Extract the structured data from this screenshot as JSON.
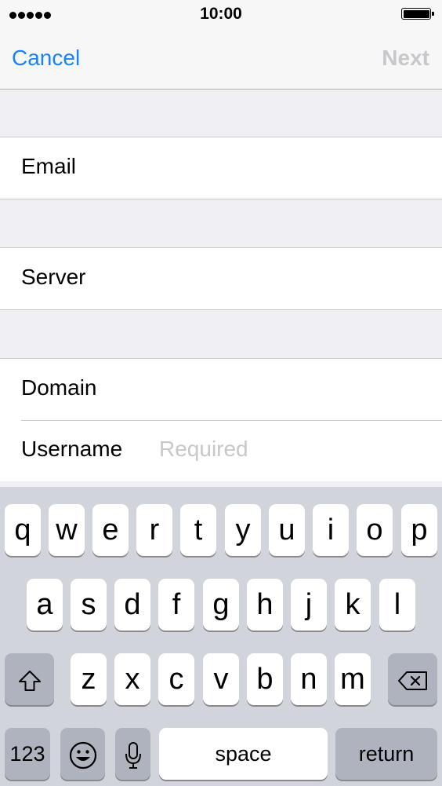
{
  "status_bar": {
    "time": "10:00",
    "signal_dots": 5
  },
  "nav": {
    "cancel_label": "Cancel",
    "next_label": "Next"
  },
  "form": {
    "email_label": "Email",
    "server_label": "Server",
    "domain_label": "Domain",
    "username_label": "Username",
    "username_placeholder": "Required"
  },
  "keyboard": {
    "row1": [
      "q",
      "w",
      "e",
      "r",
      "t",
      "y",
      "u",
      "i",
      "o",
      "p"
    ],
    "row2": [
      "a",
      "s",
      "d",
      "f",
      "g",
      "h",
      "j",
      "k",
      "l"
    ],
    "row3": [
      "z",
      "x",
      "c",
      "v",
      "b",
      "n",
      "m"
    ],
    "numbers_label": "123",
    "space_label": "space",
    "return_label": "return"
  },
  "icons": [
    "signal-dots-icon",
    "battery-icon",
    "shift-icon",
    "delete-icon",
    "emoji-icon",
    "microphone-icon"
  ]
}
